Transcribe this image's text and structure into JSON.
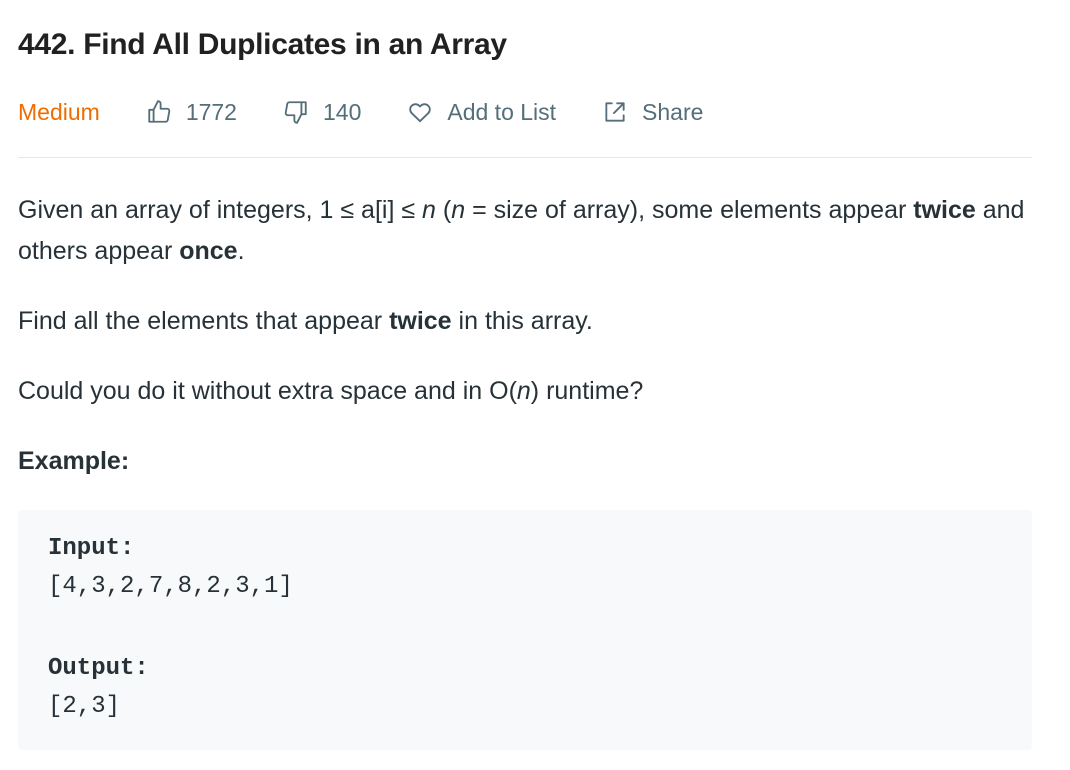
{
  "problem": {
    "title": "442. Find All Duplicates in an Array",
    "difficulty": "Medium",
    "likes": "1772",
    "dislikes": "140",
    "add_to_list_label": "Add to List",
    "share_label": "Share"
  },
  "description": {
    "p1_a": "Given an array of integers, 1 ≤ a[i] ≤ ",
    "p1_n1": "n",
    "p1_b": " (",
    "p1_n2": "n",
    "p1_c": " = size of array), some elements appear ",
    "p1_twice": "twice",
    "p1_d": " and others appear ",
    "p1_once": "once",
    "p1_e": ".",
    "p2_a": "Find all the elements that appear ",
    "p2_twice": "twice",
    "p2_b": " in this array.",
    "p3_a": "Could you do it without extra space and in O(",
    "p3_n": "n",
    "p3_b": ") runtime?",
    "example_label": "Example:"
  },
  "example": {
    "input_label": "Input:",
    "input_value": "[4,3,2,7,8,2,3,1]",
    "output_label": "Output:",
    "output_value": "[2,3]"
  },
  "icons": {
    "like": "thumbs-up-icon",
    "dislike": "thumbs-down-icon",
    "list": "heart-icon",
    "share": "share-icon"
  },
  "colors": {
    "difficulty_medium": "#ef6c00",
    "meta_text": "#546e7a",
    "example_bg": "#f7f9fa"
  }
}
